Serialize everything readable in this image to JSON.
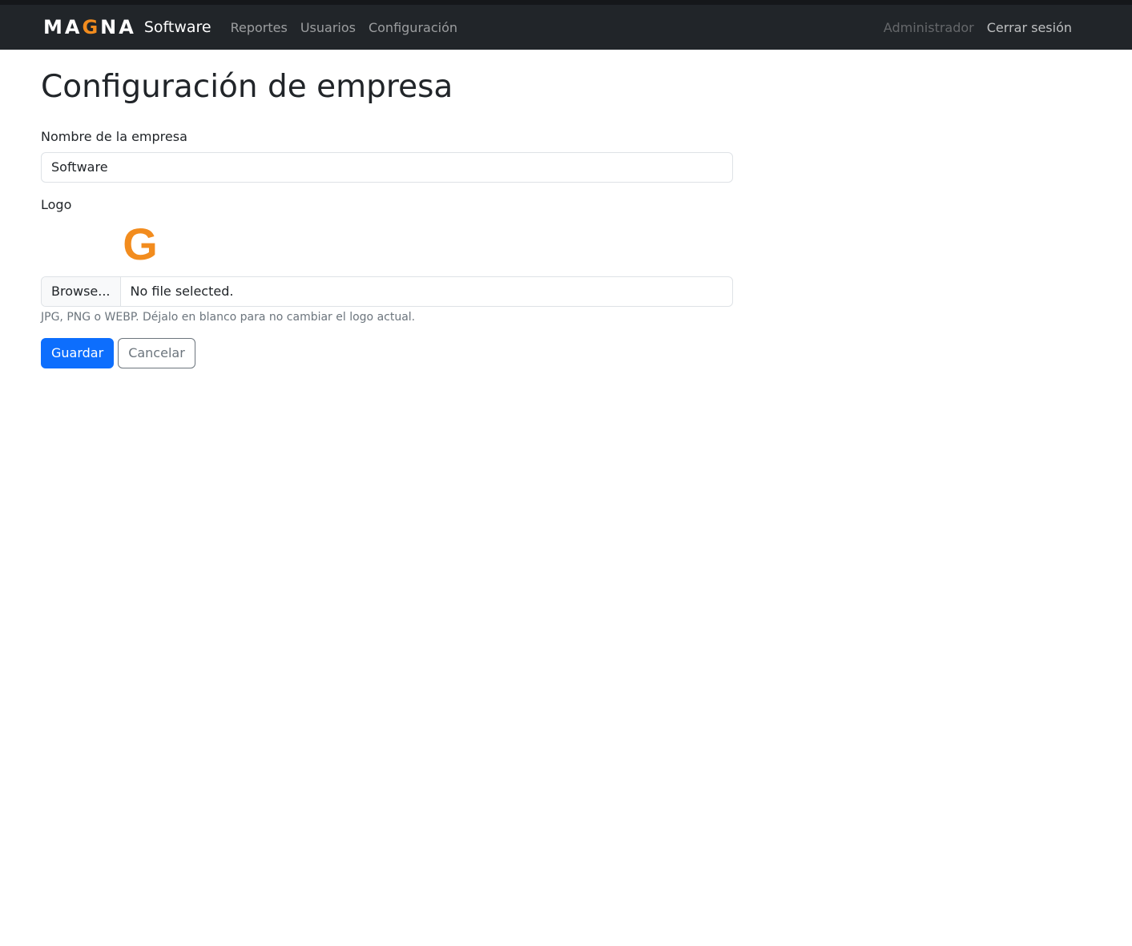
{
  "navbar": {
    "logo": {
      "part1": "MA",
      "accent": "G",
      "part2": "NA"
    },
    "brand_name": "Software",
    "links": [
      {
        "label": "Reportes"
      },
      {
        "label": "Usuarios"
      },
      {
        "label": "Configuración"
      }
    ],
    "user": "Administrador",
    "logout": "Cerrar sesión"
  },
  "page": {
    "title": "Configuración de empresa"
  },
  "form": {
    "company_name_label": "Nombre de la empresa",
    "company_name_value": "Software",
    "logo_label": "Logo",
    "logo_preview_glyph": "G",
    "file_button": "Browse...",
    "file_status": "No file selected.",
    "help_text": "JPG, PNG o WEBP. Déjalo en blanco para no cambiar el logo actual.",
    "save_label": "Guardar",
    "cancel_label": "Cancelar"
  },
  "colors": {
    "navbar_bg": "#212529",
    "accent_orange": "#f28c1e",
    "primary": "#0d6efd",
    "secondary": "#6c757d"
  }
}
